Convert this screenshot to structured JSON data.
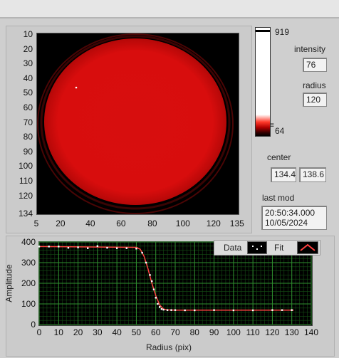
{
  "image_view": {
    "y_ticks": [
      "10",
      "20",
      "30",
      "40",
      "50",
      "60",
      "70",
      "80",
      "90",
      "100",
      "110",
      "120",
      "134"
    ],
    "x_ticks": [
      "5",
      "20",
      "40",
      "60",
      "80",
      "100",
      "120",
      "135"
    ]
  },
  "colorbar": {
    "max_label": "919",
    "min_label": "64"
  },
  "indicators": {
    "intensity_label": "intensity",
    "intensity_value": "76",
    "radius_label": "radius",
    "radius_value": "120",
    "center_label": "center",
    "center_x": "134.4",
    "center_y": "138.6",
    "lastmod_label": "last mod",
    "lastmod_time": "20:50:34.000",
    "lastmod_date": "10/05/2024"
  },
  "plot": {
    "legend": {
      "data_label": "Data",
      "fit_label": "Fit"
    },
    "colors": {
      "background": "#000000",
      "grid": "#2f8f2f",
      "data": "#ffffff",
      "fit": "#ff4040"
    }
  },
  "chart_data": {
    "type": "scatter",
    "xlabel": "Radius (pix)",
    "ylabel": "Amplitude",
    "xlim": [
      0,
      140
    ],
    "ylim": [
      0,
      400
    ],
    "x_ticks": [
      "0",
      "10",
      "20",
      "30",
      "40",
      "50",
      "60",
      "70",
      "80",
      "90",
      "100",
      "110",
      "120",
      "130",
      "140"
    ],
    "y_ticks": [
      "0",
      "100",
      "200",
      "300",
      "400"
    ],
    "series": [
      {
        "name": "Data",
        "type": "scatter",
        "x": [
          0,
          5,
          10,
          15,
          20,
          25,
          30,
          35,
          40,
          45,
          50,
          53,
          55,
          57,
          58,
          59,
          60,
          61,
          62,
          63,
          64,
          66,
          68,
          70,
          75,
          80,
          90,
          100,
          110,
          120,
          125,
          130
        ],
        "y": [
          378,
          378,
          378,
          372,
          374,
          370,
          380,
          372,
          370,
          370,
          368,
          348,
          300,
          240,
          210,
          170,
          130,
          100,
          85,
          75,
          72,
          70,
          70,
          70,
          69,
          69,
          70,
          69,
          69,
          70,
          70,
          70
        ]
      },
      {
        "name": "Fit",
        "type": "line",
        "x": [
          0,
          50,
          52,
          54,
          56,
          58,
          60,
          62,
          64,
          66,
          70,
          80,
          100,
          131
        ],
        "y": [
          378,
          374,
          365,
          330,
          270,
          200,
          140,
          95,
          75,
          71,
          70,
          70,
          70,
          70
        ]
      }
    ]
  }
}
